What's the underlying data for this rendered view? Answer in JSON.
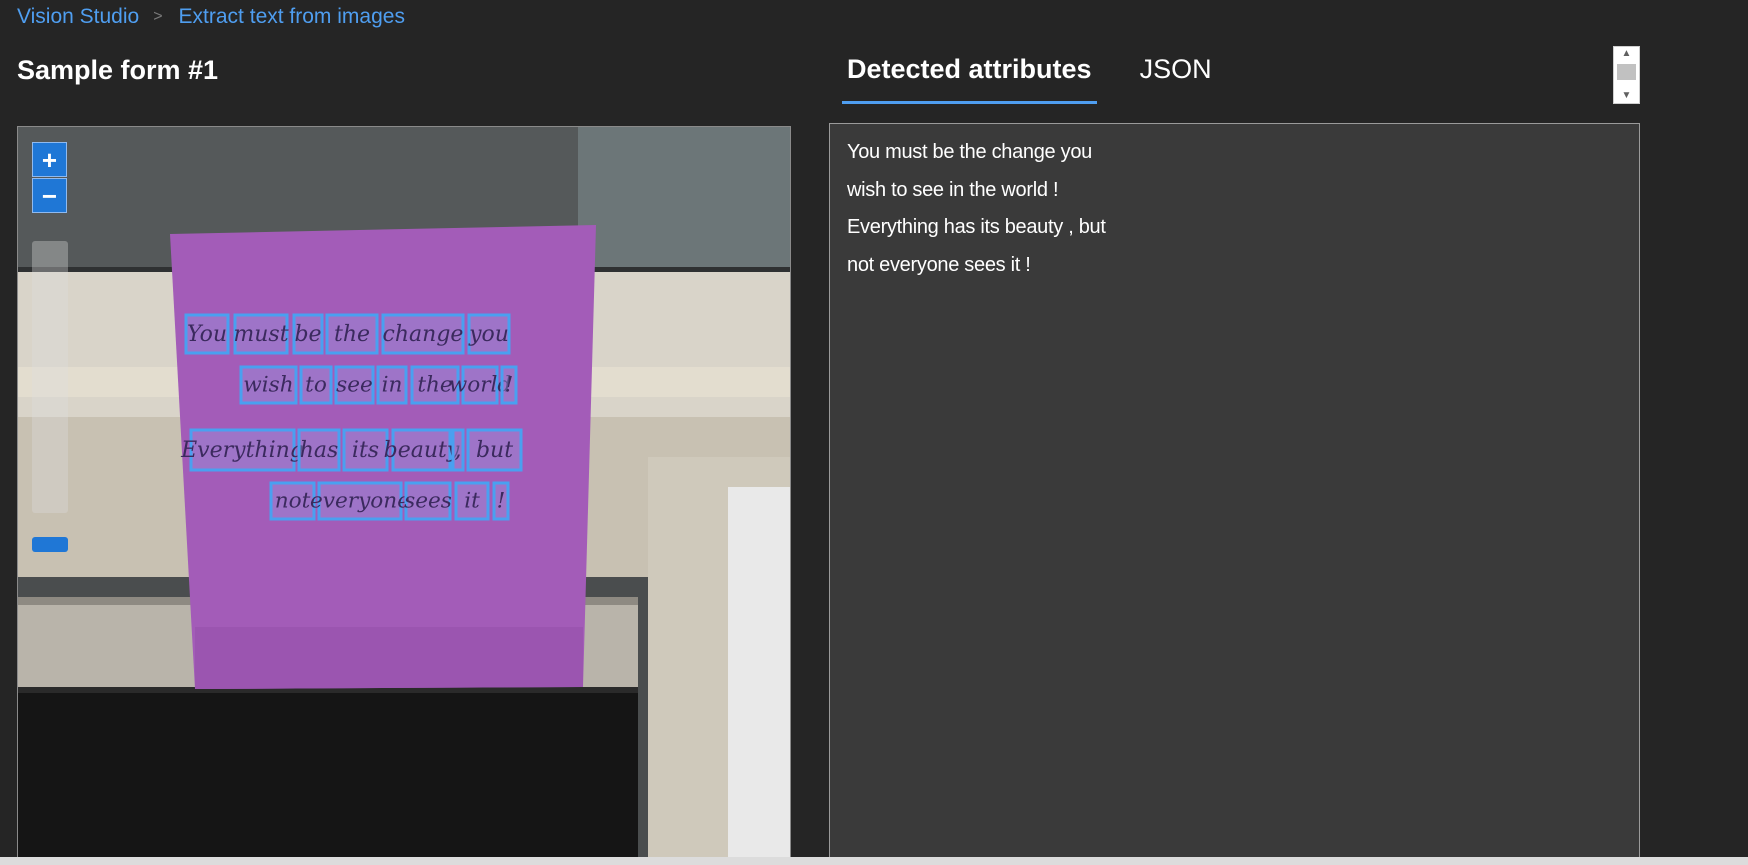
{
  "breadcrumb": {
    "root": "Vision Studio",
    "separator": ">",
    "current": "Extract text from images"
  },
  "sample": {
    "title": "Sample form #1"
  },
  "viewer": {
    "zoom_in": "+",
    "zoom_out": "−",
    "zoom_level": 0.12
  },
  "tabs": [
    {
      "label": "Detected attributes",
      "active": true
    },
    {
      "label": "JSON",
      "active": false
    }
  ],
  "results": {
    "lines": [
      "You must be the change you",
      "wish to see in the world !",
      "Everything has its beauty , but",
      "not everyone sees it !"
    ]
  },
  "note_words": [
    "You",
    "must",
    "be",
    "the",
    "change",
    "you",
    "wish",
    "to",
    "see",
    "in",
    "the",
    "world",
    "!",
    "Everything",
    "has",
    "its",
    "beauty",
    ",",
    "but",
    "not",
    "everyone",
    "sees",
    "it",
    "!"
  ],
  "colors": {
    "accent": "#4f9ef0",
    "zoom_button": "#1f77d6",
    "note": "#a35cb8",
    "box": "#4aa0f0"
  }
}
